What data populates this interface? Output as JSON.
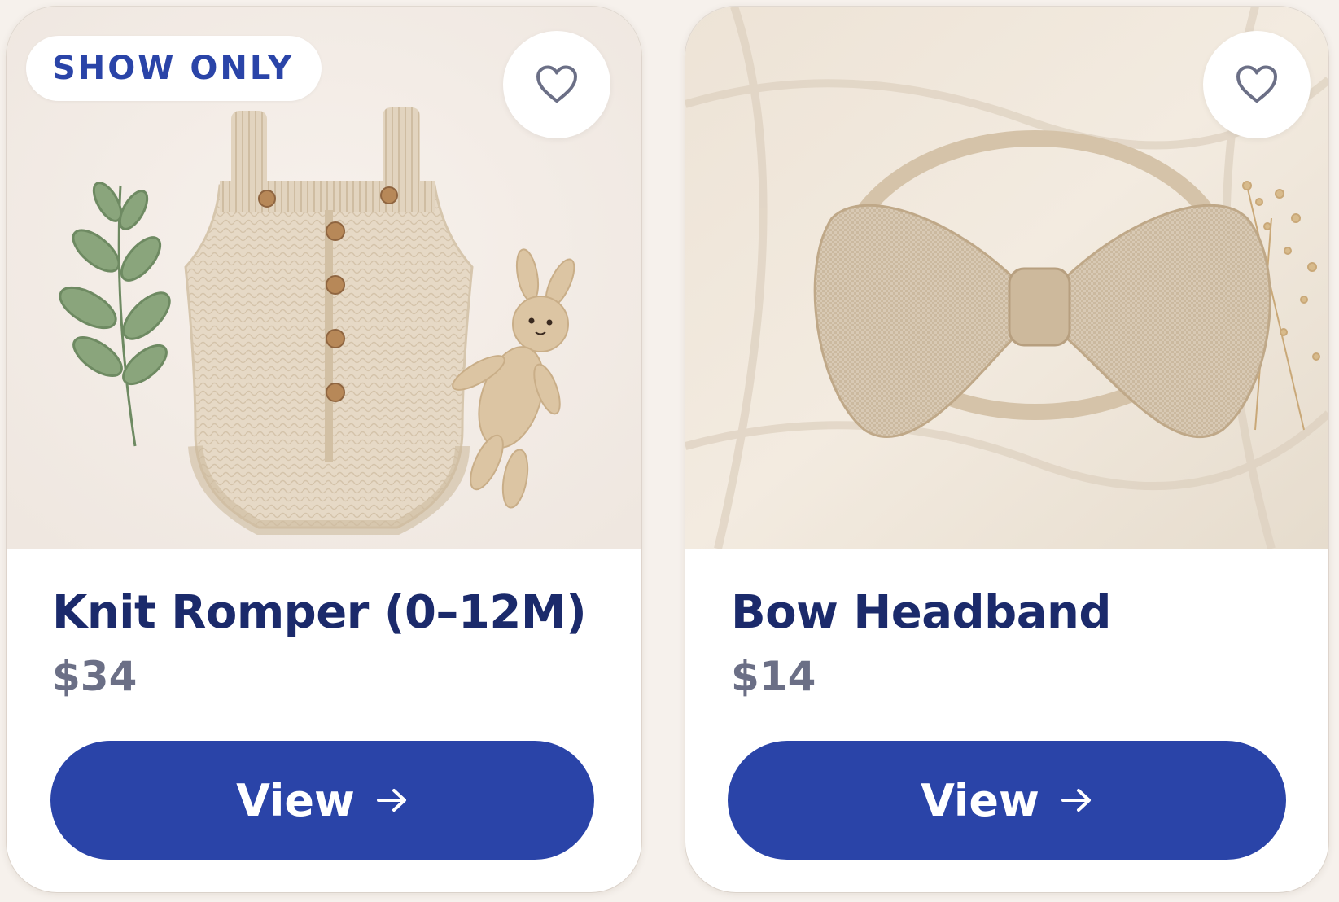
{
  "colors": {
    "accent": "#2a44a8",
    "title": "#1b2a6b",
    "price": "#6b6f86",
    "background": "#f6f1ec",
    "card": "#ffffff"
  },
  "products": [
    {
      "badge": "SHOW ONLY",
      "title": "Knit Romper (0–12M)",
      "price": "$34",
      "button_label": "View",
      "button_icon": "arrow-right-icon",
      "favorite_icon": "heart-icon",
      "image_subject": "knit-romper-photo"
    },
    {
      "title": "Bow Headband",
      "price": "$14",
      "button_label": "View",
      "button_icon": "arrow-right-icon",
      "favorite_icon": "heart-icon",
      "image_subject": "bow-headband-photo"
    }
  ]
}
